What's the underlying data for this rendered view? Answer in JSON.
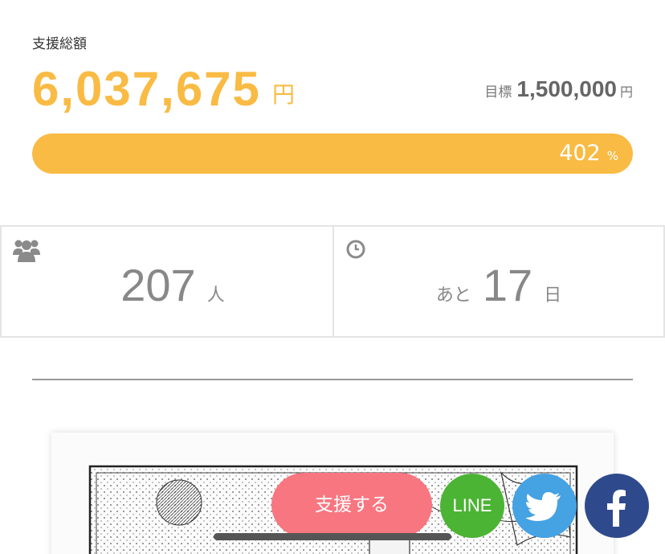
{
  "funding": {
    "label": "支援総額",
    "amount": "6,037,675",
    "unit": "円",
    "goal_label": "目標",
    "goal_value": "1,500,000",
    "goal_unit": "円",
    "progress_percent": 402,
    "progress_value": "402",
    "progress_unit": "%"
  },
  "stats": {
    "supporters": {
      "icon": "users-icon",
      "value": "207",
      "unit": "人"
    },
    "remaining": {
      "icon": "clock-icon",
      "prefix": "あと",
      "value": "17",
      "unit": "日"
    }
  },
  "actions": {
    "support_label": "支援する",
    "line_label": "LINE",
    "twitter_icon": "twitter-bird-icon",
    "facebook_icon": "facebook-f-icon"
  },
  "colors": {
    "accent": "#f9bb44",
    "support_button": "#f87680",
    "line": "#4cb434",
    "twitter": "#45a2e3",
    "facebook": "#2f4a8c"
  }
}
